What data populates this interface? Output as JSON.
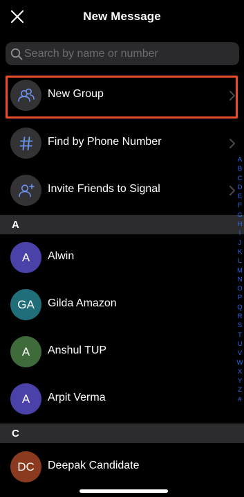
{
  "header": {
    "title": "New Message",
    "close_icon": "close-icon"
  },
  "search": {
    "placeholder": "Search by name or number",
    "value": ""
  },
  "actions": [
    {
      "label": "New Group",
      "icon": "group-icon"
    },
    {
      "label": "Find by Phone Number",
      "icon": "hash-icon"
    },
    {
      "label": "Invite Friends to Signal",
      "icon": "invite-person-icon"
    }
  ],
  "sections": [
    {
      "letter": "A",
      "contacts": [
        {
          "initials": "A",
          "name": "Alwin",
          "color": "#4a42a8"
        },
        {
          "initials": "GA",
          "name": "Gilda Amazon",
          "color": "#1f6e79"
        },
        {
          "initials": "A",
          "name": "Anshul TUP",
          "color": "#3f6b3b"
        },
        {
          "initials": "A",
          "name": "Arpit Verma",
          "color": "#4a42a8"
        }
      ]
    },
    {
      "letter": "C",
      "contacts": [
        {
          "initials": "DC",
          "name": "Deepak Candidate",
          "color": "#8a3b1f"
        }
      ]
    }
  ],
  "index_letters": [
    "A",
    "B",
    "C",
    "D",
    "E",
    "F",
    "G",
    "H",
    "I",
    "J",
    "K",
    "L",
    "M",
    "N",
    "O",
    "P",
    "Q",
    "R",
    "S",
    "T",
    "U",
    "V",
    "W",
    "X",
    "Y",
    "Z",
    "#"
  ],
  "colors": {
    "accent": "#2c6bed",
    "highlight": "#e94c2c",
    "background": "#000000",
    "section_bg": "#2c2c2e",
    "icon_circle": "#333336"
  }
}
